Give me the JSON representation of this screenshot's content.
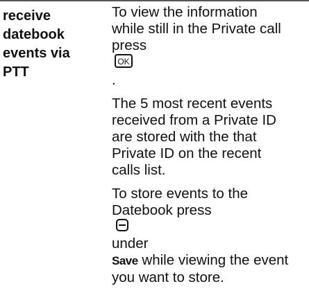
{
  "feature": {
    "title_lines": [
      "receive",
      "datebook",
      "events via",
      "PTT"
    ]
  },
  "paragraphs": {
    "p1": {
      "lines": [
        "To view the information",
        "while still in the Private call",
        "press"
      ],
      "ok_key": "OK"
    },
    "p2": {
      "lines": [
        "The 5 most recent events",
        "received from a Private ID",
        "are stored with the that",
        "Private ID on the recent",
        "calls list."
      ]
    },
    "p3": {
      "line1": "To store events to the",
      "line2_prefix": "Datebook press",
      "line2_suffix": "under",
      "line3_key": "Save",
      "line3_rest": "while viewing the event",
      "line4": "you want to store."
    }
  },
  "icons": {
    "ok_key": "ok-key-icon",
    "softkey": "softkey-minus-icon"
  }
}
